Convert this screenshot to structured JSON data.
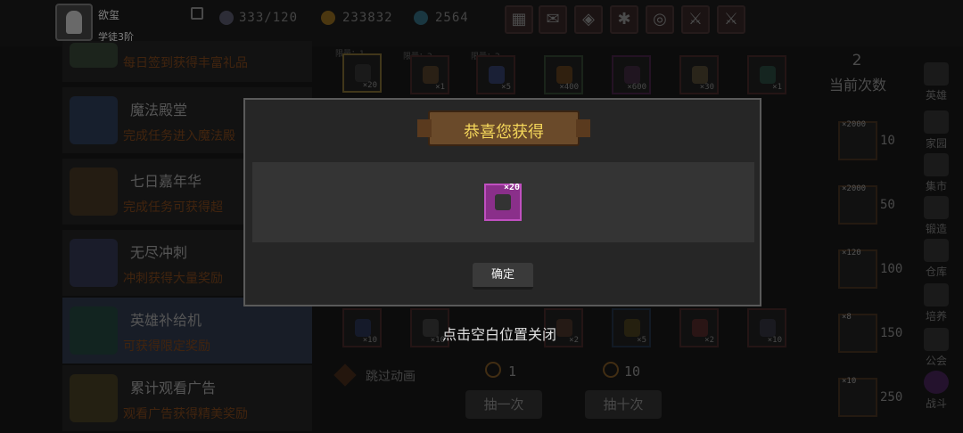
{
  "player": {
    "name": "欲玺",
    "rank": "学徒3阶"
  },
  "stats": {
    "energy": "333/120",
    "gold": "233832",
    "gems": "2564"
  },
  "toolbar_icons": [
    "shop-icon",
    "mail-icon",
    "gamepad-icon",
    "gear-icon",
    "spin-icon",
    "sword-icon",
    "alert-sword-icon"
  ],
  "events": [
    {
      "title": "",
      "desc": "每日签到获得丰富礼品"
    },
    {
      "title": "魔法殿堂",
      "desc": "完成任务进入魔法殿"
    },
    {
      "title": "七日嘉年华",
      "desc": "完成任务可获得超"
    },
    {
      "title": "无尽冲刺",
      "desc": "冲刺获得大量奖励"
    },
    {
      "title": "英雄补给机",
      "desc": "可获得限定奖励"
    },
    {
      "title": "累计观看广告",
      "desc": "观看广告获得精美奖励"
    }
  ],
  "item_grid": {
    "limits": [
      "限量：1",
      "限量：2",
      "限量：2"
    ],
    "top_row": [
      "×20",
      "×1",
      "×5",
      "×400",
      "×600",
      "×30",
      "×1"
    ],
    "bottom_row": [
      "×10",
      "×10",
      "×2",
      "×5",
      "×2",
      "×10"
    ]
  },
  "draw_count": {
    "value": "2",
    "label": "当前次数"
  },
  "pity": [
    {
      "mult": "×2000",
      "value": "10"
    },
    {
      "mult": "×2000",
      "value": "50"
    },
    {
      "mult": "×120",
      "value": "100"
    },
    {
      "mult": "×8",
      "value": "150"
    },
    {
      "mult": "×10",
      "value": "250"
    }
  ],
  "side_menu": [
    "英雄",
    "家园",
    "集市",
    "锻造",
    "仓库",
    "培养",
    "公会",
    "战斗"
  ],
  "controls": {
    "skip_label": "跳过动画",
    "single_cost": "1",
    "ten_cost": "10",
    "single_draw": "抽一次",
    "ten_draw": "抽十次"
  },
  "modal": {
    "title": "恭喜您获得",
    "reward_qty": "×20",
    "confirm": "确定"
  },
  "close_hint": "点击空白位置关闭",
  "colors": {
    "gold_text": "#f4d65a",
    "purple_rarity": "#8a2f8a",
    "desc_orange": "#6a3b18"
  }
}
